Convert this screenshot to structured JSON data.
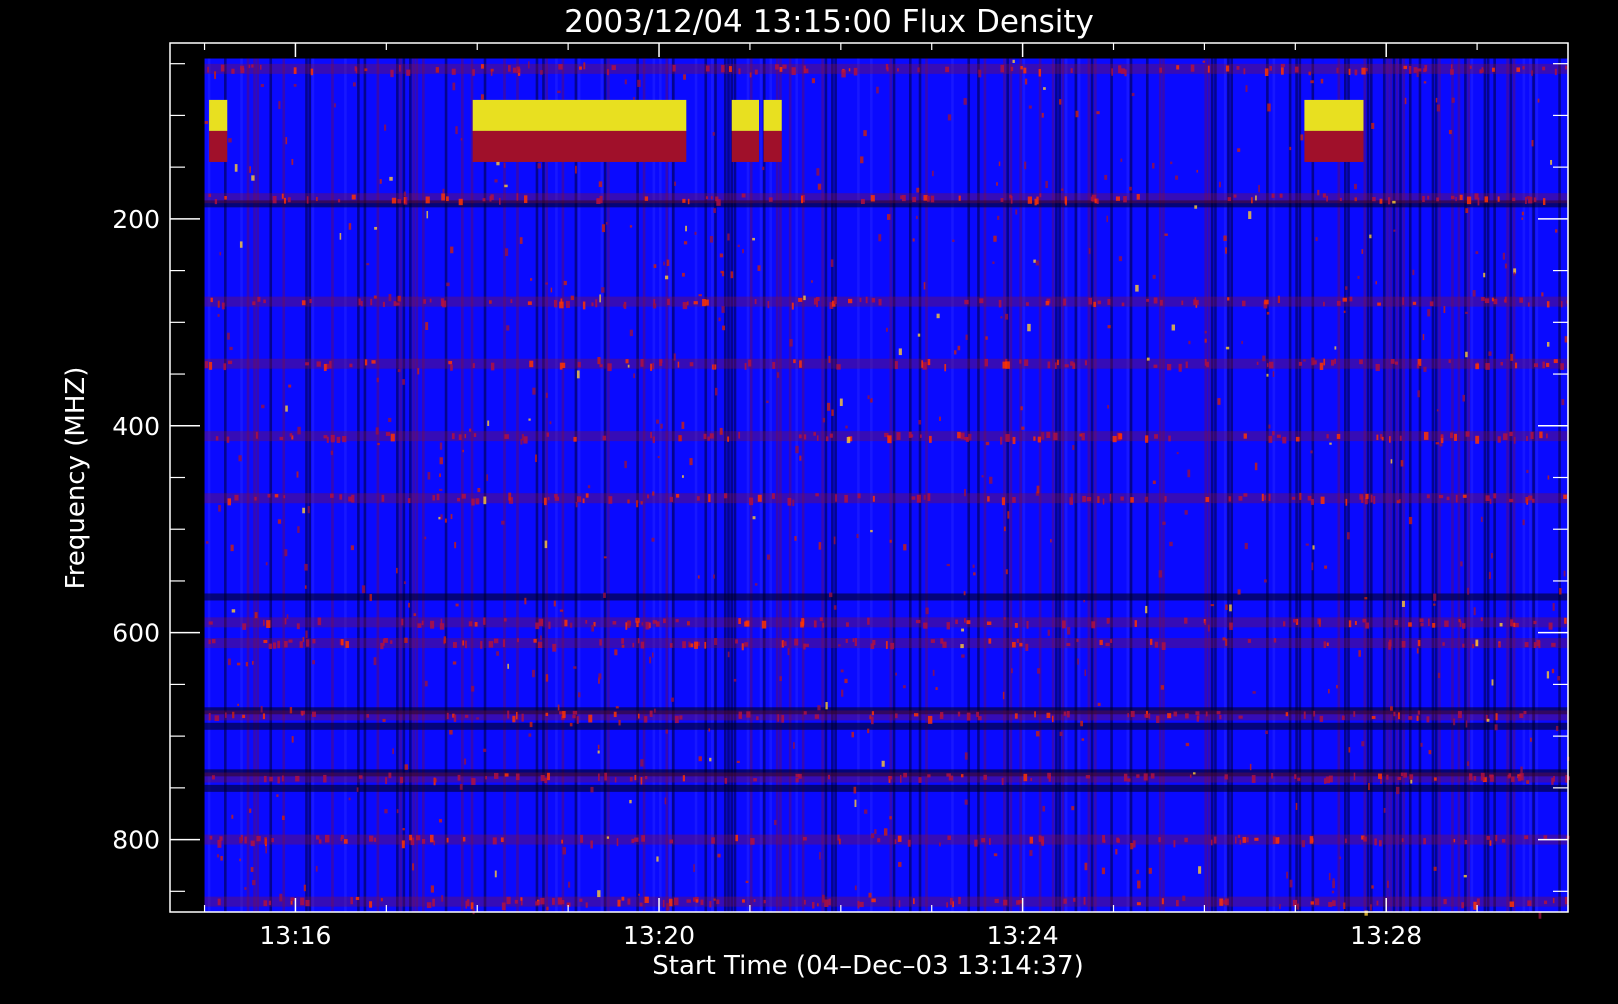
{
  "chart_data": {
    "type": "heatmap",
    "title": "2003/12/04 13:15:00 Flux Density",
    "xlabel": "Start Time (04–Dec–03 13:14:37)",
    "ylabel": "Frequency (MHZ)",
    "x_ticks": [
      "13:16",
      "13:20",
      "13:24",
      "13:28"
    ],
    "x_tick_minutes": [
      16,
      20,
      24,
      28
    ],
    "y_ticks": [
      "200",
      "400",
      "600",
      "800"
    ],
    "y_tick_values": [
      200,
      400,
      600,
      800
    ],
    "xlim_minutes": [
      14.62,
      30.0
    ],
    "ylim_mhz": [
      30,
      870
    ],
    "data_start_minute": 15.0,
    "data_end_minute": 30.0,
    "freq_top_mhz": 45,
    "freq_bottom_mhz": 870,
    "colormap": [
      "#000000",
      "#1a1aee",
      "#0000ff",
      "#8a1030",
      "#ff2a00",
      "#ffff66"
    ],
    "background": "#0a0aff",
    "saturated_bursts": [
      {
        "start_minute": 15.05,
        "end_minute": 15.25,
        "freq_mhz": [
          85,
          145
        ]
      },
      {
        "start_minute": 17.95,
        "end_minute": 20.3,
        "freq_mhz": [
          85,
          145
        ]
      },
      {
        "start_minute": 20.8,
        "end_minute": 21.1,
        "freq_mhz": [
          85,
          145
        ]
      },
      {
        "start_minute": 21.15,
        "end_minute": 21.35,
        "freq_mhz": [
          85,
          145
        ]
      },
      {
        "start_minute": 27.1,
        "end_minute": 27.75,
        "freq_mhz": [
          85,
          145
        ]
      }
    ],
    "bright_bands_mhz": [
      55,
      180,
      280,
      340,
      410,
      470,
      590,
      610,
      680,
      740,
      800,
      860
    ],
    "dark_bands_mhz": [
      185,
      565,
      675,
      690,
      735,
      750
    ]
  }
}
